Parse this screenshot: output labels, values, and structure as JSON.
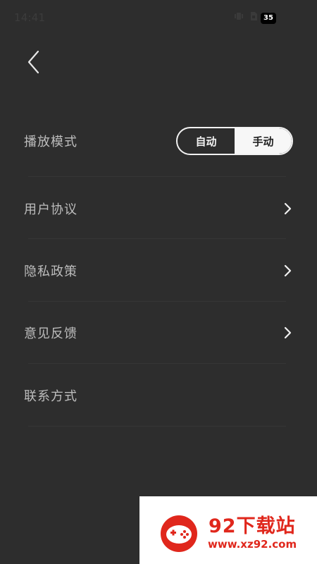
{
  "status_bar": {
    "time": "14:41",
    "battery": "35",
    "icons": [
      "vibrate-icon",
      "sim-icon",
      "wifi-icon",
      "battery-icon"
    ]
  },
  "nav": {
    "back_icon": "chevron-left-icon"
  },
  "settings": {
    "play_mode": {
      "label": "播放模式",
      "options": [
        "自动",
        "手动"
      ],
      "selected": "手动"
    },
    "items": [
      {
        "label": "用户协议",
        "has_chevron": true
      },
      {
        "label": "隐私政策",
        "has_chevron": true
      },
      {
        "label": "意见反馈",
        "has_chevron": true
      },
      {
        "label": "联系方式",
        "has_chevron": false
      }
    ]
  },
  "watermark": {
    "title": "92下载站",
    "url": "www.xz92.com",
    "color": "#e0271c"
  },
  "colors": {
    "background": "#2d2d2d",
    "text": "#bdbdbd",
    "divider": "#363636"
  }
}
